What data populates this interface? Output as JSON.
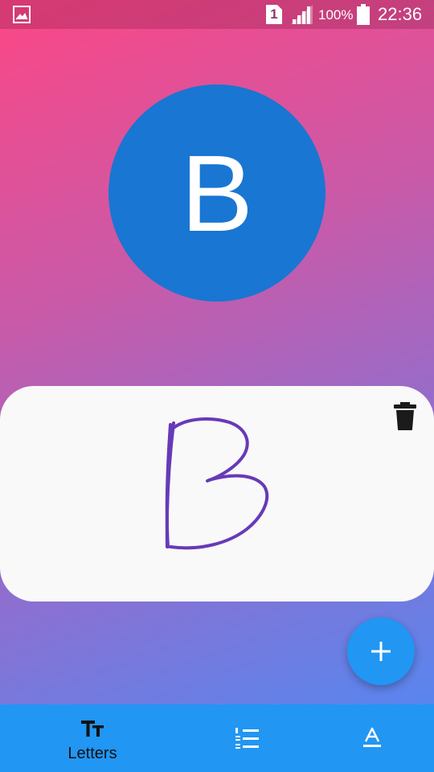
{
  "status_bar": {
    "sim_slot": "1",
    "battery_percent": "100%",
    "time": "22:36",
    "icons": [
      "gallery-icon",
      "sim-icon",
      "signal-icon",
      "battery-icon"
    ]
  },
  "letter_display": {
    "letter": "B",
    "circle_color": "#1976d2"
  },
  "drawing_card": {
    "stroke_color": "#673ab7",
    "delete_icon": "trash-icon"
  },
  "fab": {
    "icon": "plus-icon",
    "color": "#2196f3"
  },
  "bottom_nav": {
    "items": [
      {
        "label": "Letters",
        "icon": "text-size-icon",
        "active": true
      },
      {
        "label": "",
        "icon": "numbered-list-icon",
        "active": false
      },
      {
        "label": "",
        "icon": "font-style-icon",
        "active": false
      }
    ]
  }
}
